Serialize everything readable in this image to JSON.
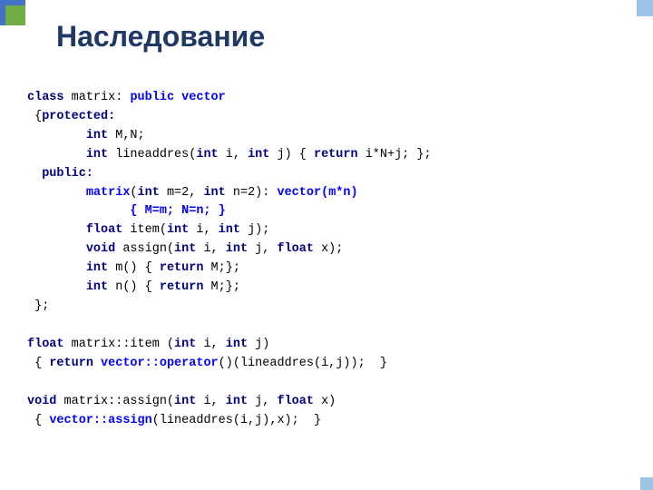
{
  "slide": {
    "title": "Наследование",
    "code_lines": [
      {
        "type": "mixed",
        "id": "line1"
      },
      {
        "type": "mixed",
        "id": "line2"
      },
      {
        "type": "mixed",
        "id": "line3"
      },
      {
        "type": "mixed",
        "id": "line4"
      },
      {
        "type": "mixed",
        "id": "line5"
      },
      {
        "type": "mixed",
        "id": "line6"
      },
      {
        "type": "mixed",
        "id": "line7"
      },
      {
        "type": "mixed",
        "id": "line8"
      },
      {
        "type": "mixed",
        "id": "line9"
      },
      {
        "type": "mixed",
        "id": "line10"
      },
      {
        "type": "mixed",
        "id": "line11"
      },
      {
        "type": "mixed",
        "id": "line12"
      },
      {
        "type": "mixed",
        "id": "line13"
      },
      {
        "type": "mixed",
        "id": "line14"
      },
      {
        "type": "mixed",
        "id": "line15"
      },
      {
        "type": "mixed",
        "id": "line16"
      },
      {
        "type": "mixed",
        "id": "line17"
      },
      {
        "type": "mixed",
        "id": "line18"
      }
    ]
  }
}
